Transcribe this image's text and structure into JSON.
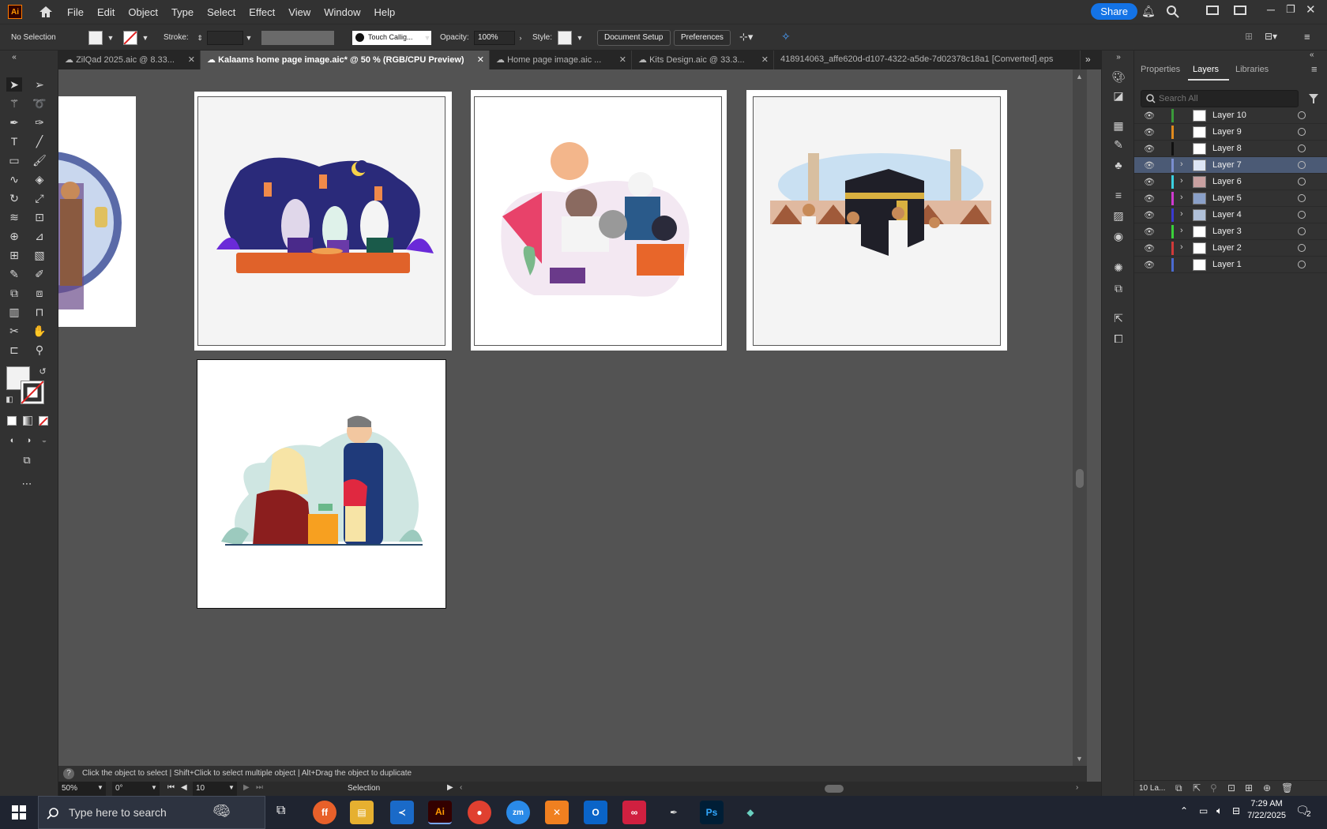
{
  "app": {
    "logo": "Ai"
  },
  "menu": [
    "File",
    "Edit",
    "Object",
    "Type",
    "Select",
    "Effect",
    "View",
    "Window",
    "Help"
  ],
  "share_label": "Share",
  "control": {
    "selection": "No Selection",
    "stroke_label": "Stroke:",
    "brush": "Touch Callig...",
    "opacity_label": "Opacity:",
    "opacity_value": "100%",
    "style_label": "Style:",
    "doc_setup": "Document Setup",
    "preferences": "Preferences"
  },
  "tabs": [
    {
      "label": "ZilQad 2025.aic @ 8.33...",
      "active": false
    },
    {
      "label": "Kalaams home page image.aic* @ 50 % (RGB/CPU Preview)",
      "active": true
    },
    {
      "label": "Home page image.aic ...",
      "active": false
    },
    {
      "label": "Kits Design.aic @ 33.3...",
      "active": false
    },
    {
      "label": "418914063_affe620d-d107-4322-a5de-7d02378c18a1 [Converted].eps",
      "active": false
    }
  ],
  "panel": {
    "tabs": [
      "Properties",
      "Layers",
      "Libraries"
    ],
    "search_placeholder": "Search All",
    "layers": [
      {
        "name": "Layer 10",
        "color": "#3a9a3a",
        "expandable": false,
        "selected": false
      },
      {
        "name": "Layer 9",
        "color": "#e08a1e",
        "expandable": false,
        "selected": false
      },
      {
        "name": "Layer 8",
        "color": "#111111",
        "expandable": false,
        "selected": false
      },
      {
        "name": "Layer 7",
        "color": "#7a8ed0",
        "expandable": true,
        "selected": true
      },
      {
        "name": "Layer 6",
        "color": "#3ad0e0",
        "expandable": true,
        "selected": false
      },
      {
        "name": "Layer 5",
        "color": "#d03ad0",
        "expandable": true,
        "selected": false
      },
      {
        "name": "Layer 4",
        "color": "#3a3ad0",
        "expandable": true,
        "selected": false
      },
      {
        "name": "Layer 3",
        "color": "#3ad03a",
        "expandable": true,
        "selected": false
      },
      {
        "name": "Layer 2",
        "color": "#d03a3a",
        "expandable": true,
        "selected": false
      },
      {
        "name": "Layer 1",
        "color": "#4a6ad0",
        "expandable": false,
        "selected": false
      }
    ],
    "layer_count": "10 La..."
  },
  "status": {
    "hint": "Click the object to select  |  Shift+Click to select multiple object  |  Alt+Drag the object to duplicate",
    "zoom": "50%",
    "angle": "0°",
    "artboard_num": "10",
    "mode": "Selection"
  },
  "taskbar": {
    "search_placeholder": "Type here to search",
    "time": "7:29 AM",
    "date": "7/22/2025",
    "notifications": "2"
  },
  "colors": {
    "accent": "#1473e6",
    "selected_layer": "#4b5a75"
  }
}
